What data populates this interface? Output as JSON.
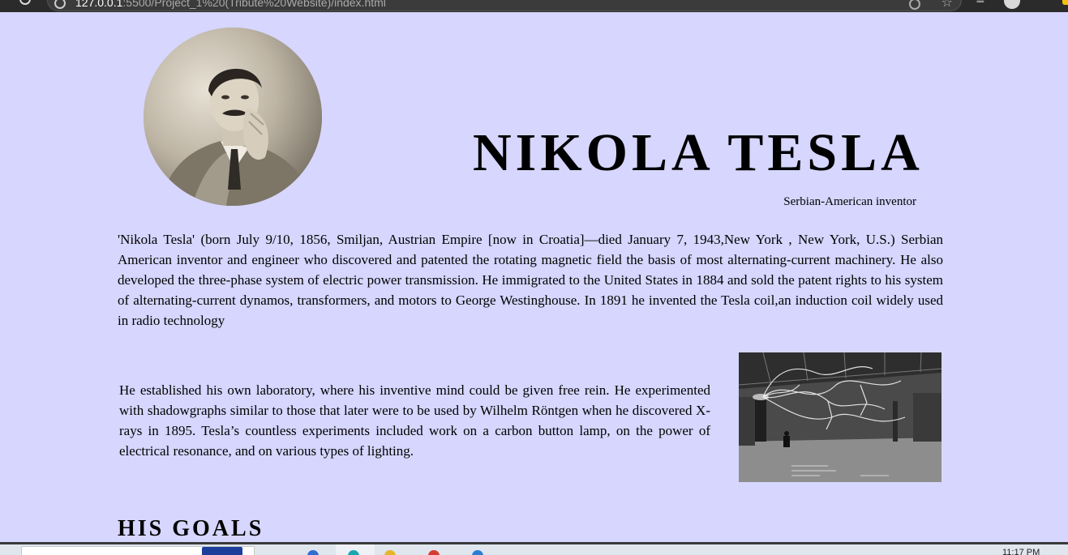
{
  "browser": {
    "url_host": "127.0.0.1",
    "url_rest": ":5500/Project_1%20(Tribute%20Website)/index.html",
    "icons": [
      "back-icon",
      "site-info-icon",
      "reload-icon",
      "favorite-icon",
      "reading-list-icon",
      "profile-icon",
      "more-icon"
    ]
  },
  "page": {
    "title": "NIKOLA TESLA",
    "subtitle": "Serbian-American inventor",
    "intro": "'Nikola Tesla' (born July 9/10, 1856, Smiljan, Austrian Empire [now in Croatia]—died January 7, 1943,New York , New York, U.S.) Serbian American inventor and engineer who discovered and patented the rotating magnetic field the basis of most alternating-current machinery. He also developed the three-phase system of electric power transmission. He immigrated to the United States in 1884 and sold the patent rights to his system of alternating-current dynamos, transformers, and motors to George Westinghouse. In 1891 he invented the Tesla coil,an induction coil widely used in radio technology",
    "lab_paragraph": "He established his own laboratory, where his inventive mind could be given free rein. He experimented with shadowgraphs similar to those that later were to be used by Wilhelm Röntgen when he discovered X-rays in 1895. Tesla’s countless experiments included work on a carbon button lamp, on the power of electrical resonance, and on various types of lighting.",
    "section_heading": "HIS GOALS",
    "portrait_image": "tesla-portrait",
    "lab_image": "tesla-laboratory-photo"
  },
  "taskbar": {
    "clock": "11:17 PM",
    "colors": {
      "page_background": "#d6d6fe",
      "taskbar_background": "#dfe6ee"
    }
  }
}
